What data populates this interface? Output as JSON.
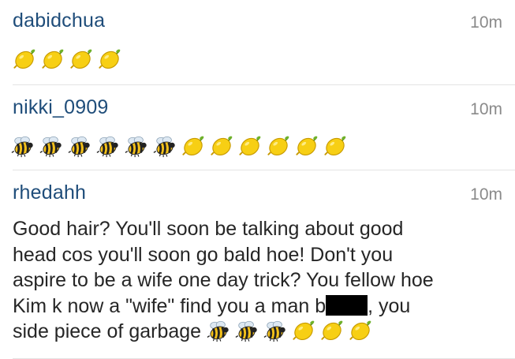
{
  "comments": [
    {
      "username": "dabidchua",
      "time": "10m",
      "emojis": [
        "lemon",
        "lemon",
        "lemon",
        "lemon"
      ]
    },
    {
      "username": "nikki_0909",
      "time": "10m",
      "emojis": [
        "bee",
        "bee",
        "bee",
        "bee",
        "bee",
        "bee",
        "lemon",
        "lemon",
        "lemon",
        "lemon",
        "lemon",
        "lemon"
      ]
    },
    {
      "username": "rhedahh",
      "time": "10m",
      "text_line1": "Good hair? You'll soon be talking about good",
      "text_line2": "head cos you'll soon go bald hoe! Don't you",
      "text_line3": "aspire to be a wife one day trick? You fellow hoe",
      "text_line4_start": "Kim k now a \"wife\" find you a man b",
      "text_line4_end": ", you",
      "text_line5": "side piece of garbage",
      "trailing_emojis": [
        "bee",
        "bee",
        "bee",
        "lemon",
        "lemon",
        "lemon"
      ]
    }
  ],
  "colors": {
    "username": "#1f4d7a",
    "timestamp": "#8a8a8a",
    "text": "#262626",
    "divider": "#e4e4e4"
  }
}
